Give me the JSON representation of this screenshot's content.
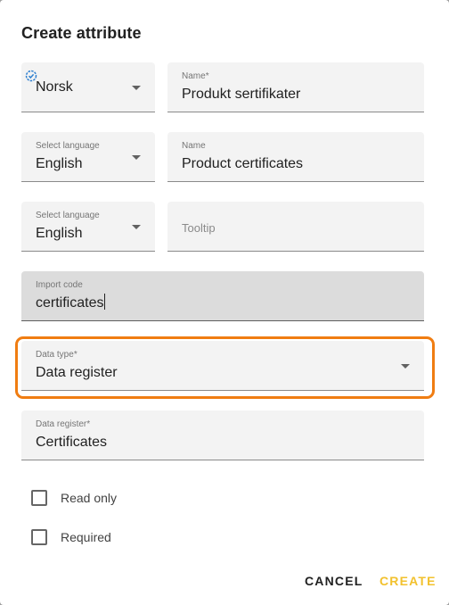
{
  "dialog": {
    "title": "Create attribute"
  },
  "rows": [
    {
      "language": {
        "label": "",
        "value": "Norsk",
        "verified": true
      },
      "name": {
        "label": "Name",
        "required": "*",
        "value": "Produkt sertifikater"
      }
    },
    {
      "language": {
        "label": "Select language",
        "value": "English"
      },
      "name": {
        "label": "Name",
        "value": "Product certificates"
      }
    },
    {
      "language": {
        "label": "Select language",
        "value": "English"
      },
      "tooltip": {
        "placeholder": "Tooltip"
      }
    }
  ],
  "import_code": {
    "label": "Import code",
    "value": "certificates"
  },
  "data_type": {
    "label": "Data type",
    "required": "*",
    "value": "Data register"
  },
  "data_register": {
    "label": "Data register",
    "required": "*",
    "value": "Certificates"
  },
  "checkboxes": [
    {
      "label": "Read only",
      "checked": false
    },
    {
      "label": "Required",
      "checked": false
    }
  ],
  "actions": {
    "cancel": "CANCEL",
    "create": "CREATE"
  },
  "colors": {
    "highlight": "#f07d12",
    "create_button": "#f2c12e",
    "verified_icon": "#2f80d0"
  }
}
